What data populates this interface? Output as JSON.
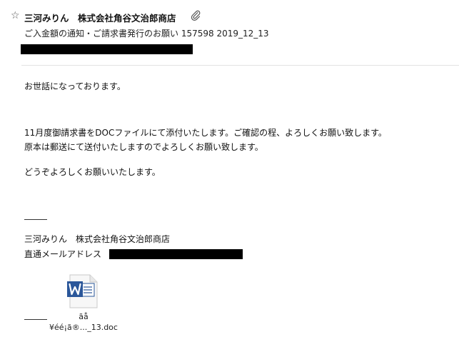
{
  "header": {
    "star_glyph": "☆",
    "sender": "三河みりん　株式会社角谷文治郎商店",
    "subject": "ご入金額の通知・ご請求書発行のお願い 157598 2019_12_13"
  },
  "body": {
    "greeting": "お世話になっております。",
    "para1_line1": "11月度御請求書をDOCファイルにて添付いたします。ご確認の程、よろしくお願い致します。",
    "para1_line2": "原本は郵送にて送付いたしますのでよろしくお願い致します。",
    "closing": "どうぞよろしくお願いいたします。"
  },
  "signature": {
    "name": "三河みりん　株式会社角谷文治郎商店",
    "email_label": "直通メールアドレス"
  },
  "attachment": {
    "icon": "word-document-icon",
    "name_line1": "ãå",
    "name_line2": "¥éé¡ã®..._13.doc"
  },
  "colors": {
    "word_blue": "#2b579a",
    "redaction": "#000000"
  }
}
